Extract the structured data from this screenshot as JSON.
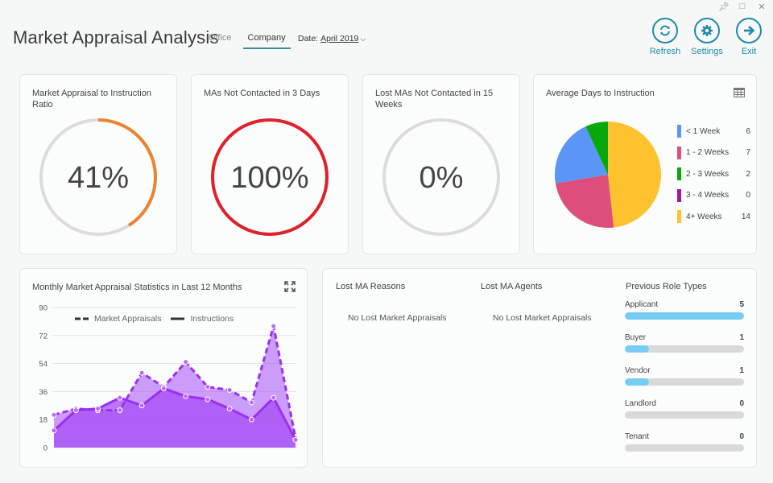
{
  "window": {
    "controls": [
      "pin-icon",
      "maximize-icon",
      "close-icon"
    ]
  },
  "header": {
    "title": "Market Appraisal Analysis",
    "tabs": [
      {
        "label": "Office",
        "active": false
      },
      {
        "label": "Company",
        "active": true
      }
    ],
    "date_label": "Date:",
    "date_value": "April 2019",
    "actions": [
      {
        "label": "Refresh",
        "icon": "refresh-icon"
      },
      {
        "label": "Settings",
        "icon": "gear-icon"
      },
      {
        "label": "Exit",
        "icon": "arrow-right-icon"
      }
    ],
    "accent": "#1f8aa8"
  },
  "kpis": [
    {
      "title": "Market Appraisal to Instruction Ratio",
      "value": "41%",
      "percent": 41,
      "color": "#ec8331"
    },
    {
      "title": "MAs Not Contacted in 3 Days",
      "value": "100%",
      "percent": 100,
      "color": "#e0202a"
    },
    {
      "title": "Lost MAs Not Contacted in 15 Weeks",
      "value": "0%",
      "percent": 0,
      "color": "#d9d9d9"
    }
  ],
  "avg_days": {
    "title": "Average Days to Instruction",
    "icon": "table-icon",
    "legend": [
      {
        "label": "< 1 Week",
        "value": "6"
      },
      {
        "label": "1 - 2 Weeks",
        "value": "7"
      },
      {
        "label": "2 - 3 Weeks",
        "value": "2"
      },
      {
        "label": "3 - 4 Weeks",
        "value": "0"
      },
      {
        "label": "4+ Weeks",
        "value": "14"
      }
    ]
  },
  "chart_data": [
    {
      "type": "pie",
      "title": "Average Days to Instruction",
      "categories": [
        "< 1 Week",
        "1 - 2 Weeks",
        "2 - 3 Weeks",
        "3 - 4 Weeks",
        "4+ Weeks"
      ],
      "values": [
        6,
        7,
        2,
        0,
        14
      ],
      "colors": [
        "#5996f5",
        "#dd4f7a",
        "#07a80c",
        "#a0199c",
        "#fdc22d"
      ],
      "legend": "right"
    },
    {
      "type": "area",
      "title": "Monthly Market Appraisal Statistics in Last 12 Months",
      "xlabel": "",
      "ylabel": "",
      "ylim": [
        0,
        90
      ],
      "yticks": [
        0,
        18,
        36,
        54,
        72,
        90
      ],
      "grid": true,
      "legend": "top",
      "x": [
        1,
        2,
        3,
        4,
        5,
        6,
        7,
        8,
        9,
        10,
        11,
        12
      ],
      "series": [
        {
          "name": "Market Appraisals",
          "style": "dashed",
          "values": [
            21,
            25,
            24,
            24,
            48,
            39,
            55,
            39,
            37,
            29,
            78,
            6
          ]
        },
        {
          "name": "Instructions",
          "style": "solid",
          "values": [
            11,
            24,
            25,
            32,
            27,
            38,
            33,
            31,
            25,
            18,
            32,
            5
          ]
        }
      ],
      "color": "#a44cf5"
    },
    {
      "type": "bar",
      "title": "Previous Role Types",
      "categories": [
        "Applicant",
        "Buyer",
        "Vendor",
        "Landlord",
        "Tenant"
      ],
      "values": [
        5,
        1,
        1,
        0,
        0
      ],
      "color": "#76cdf3"
    }
  ],
  "monthly": {
    "title": "Monthly Market Appraisal Statistics in Last 12 Months",
    "legend": [
      "Market Appraisals",
      "Instructions"
    ],
    "yticks": [
      "0",
      "18",
      "36",
      "54",
      "72",
      "90"
    ]
  },
  "lost": {
    "reasons_title": "Lost MA Reasons",
    "reasons_empty": "No Lost Market Appraisals",
    "agents_title": "Lost MA Agents",
    "agents_empty": "No Lost Market Appraisals",
    "roles_title": "Previous Role Types",
    "roles": [
      {
        "label": "Applicant",
        "count": "5",
        "fraction": 1.0
      },
      {
        "label": "Buyer",
        "count": "1",
        "fraction": 0.2
      },
      {
        "label": "Vendor",
        "count": "1",
        "fraction": 0.2
      },
      {
        "label": "Landlord",
        "count": "0",
        "fraction": 0
      },
      {
        "label": "Tenant",
        "count": "0",
        "fraction": 0
      }
    ]
  }
}
